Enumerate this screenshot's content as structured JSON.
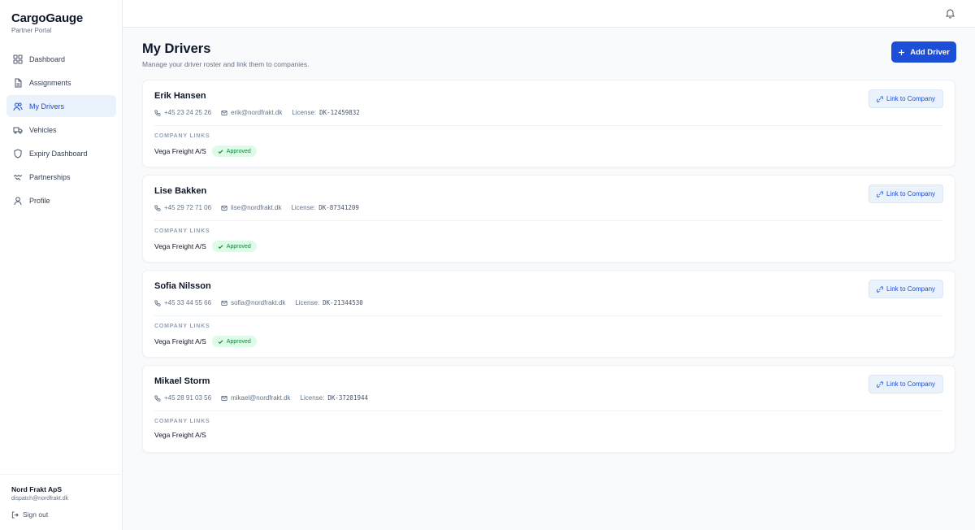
{
  "brand": {
    "title": "CargoGauge",
    "subtitle": "Partner Portal"
  },
  "sidebar": {
    "items": [
      {
        "label": "Dashboard",
        "icon": "grid-icon"
      },
      {
        "label": "Assignments",
        "icon": "document-icon"
      },
      {
        "label": "My Drivers",
        "icon": "users-icon",
        "active": true
      },
      {
        "label": "Vehicles",
        "icon": "truck-icon"
      },
      {
        "label": "Expiry Dashboard",
        "icon": "shield-icon"
      },
      {
        "label": "Partnerships",
        "icon": "handshake-icon"
      },
      {
        "label": "Profile",
        "icon": "user-icon"
      }
    ],
    "footer": {
      "org_name": "Nord Frakt ApS",
      "org_email": "dispatch@nordfrakt.dk",
      "signout_label": "Sign out"
    }
  },
  "topbar": {
    "notification_icon": "bell-icon"
  },
  "page": {
    "title": "My Drivers",
    "subtitle": "Manage your driver roster and link them to companies.",
    "add_button_label": "Add Driver"
  },
  "labels": {
    "license": "License:",
    "company_links": "COMPANY LINKS",
    "link_button": "Link to Company"
  },
  "drivers": [
    {
      "name": "Erik Hansen",
      "phone": "+45 23 24 25 26",
      "email": "erik@nordfrakt.dk",
      "license": "DK-12459832",
      "company": "Vega Freight A/S",
      "status": "Approved"
    },
    {
      "name": "Lise Bakken",
      "phone": "+45 29 72 71 06",
      "email": "lise@nordfrakt.dk",
      "license": "DK-87341209",
      "company": "Vega Freight A/S",
      "status": "Approved"
    },
    {
      "name": "Sofia Nilsson",
      "phone": "+45 33 44 55 66",
      "email": "sofia@nordfrakt.dk",
      "license": "DK-21344530",
      "company": "Vega Freight A/S",
      "status": "Approved"
    },
    {
      "name": "Mikael Storm",
      "phone": "+45 28 91 03 56",
      "email": "mikael@nordfrakt.dk",
      "license": "DK-37281944",
      "company": "Vega Freight A/S",
      "status": ""
    }
  ],
  "colors": {
    "accent": "#1d4ed8",
    "active_bg": "#eaf2fc",
    "badge_bg": "#dcfce7",
    "badge_text": "#15803d"
  }
}
